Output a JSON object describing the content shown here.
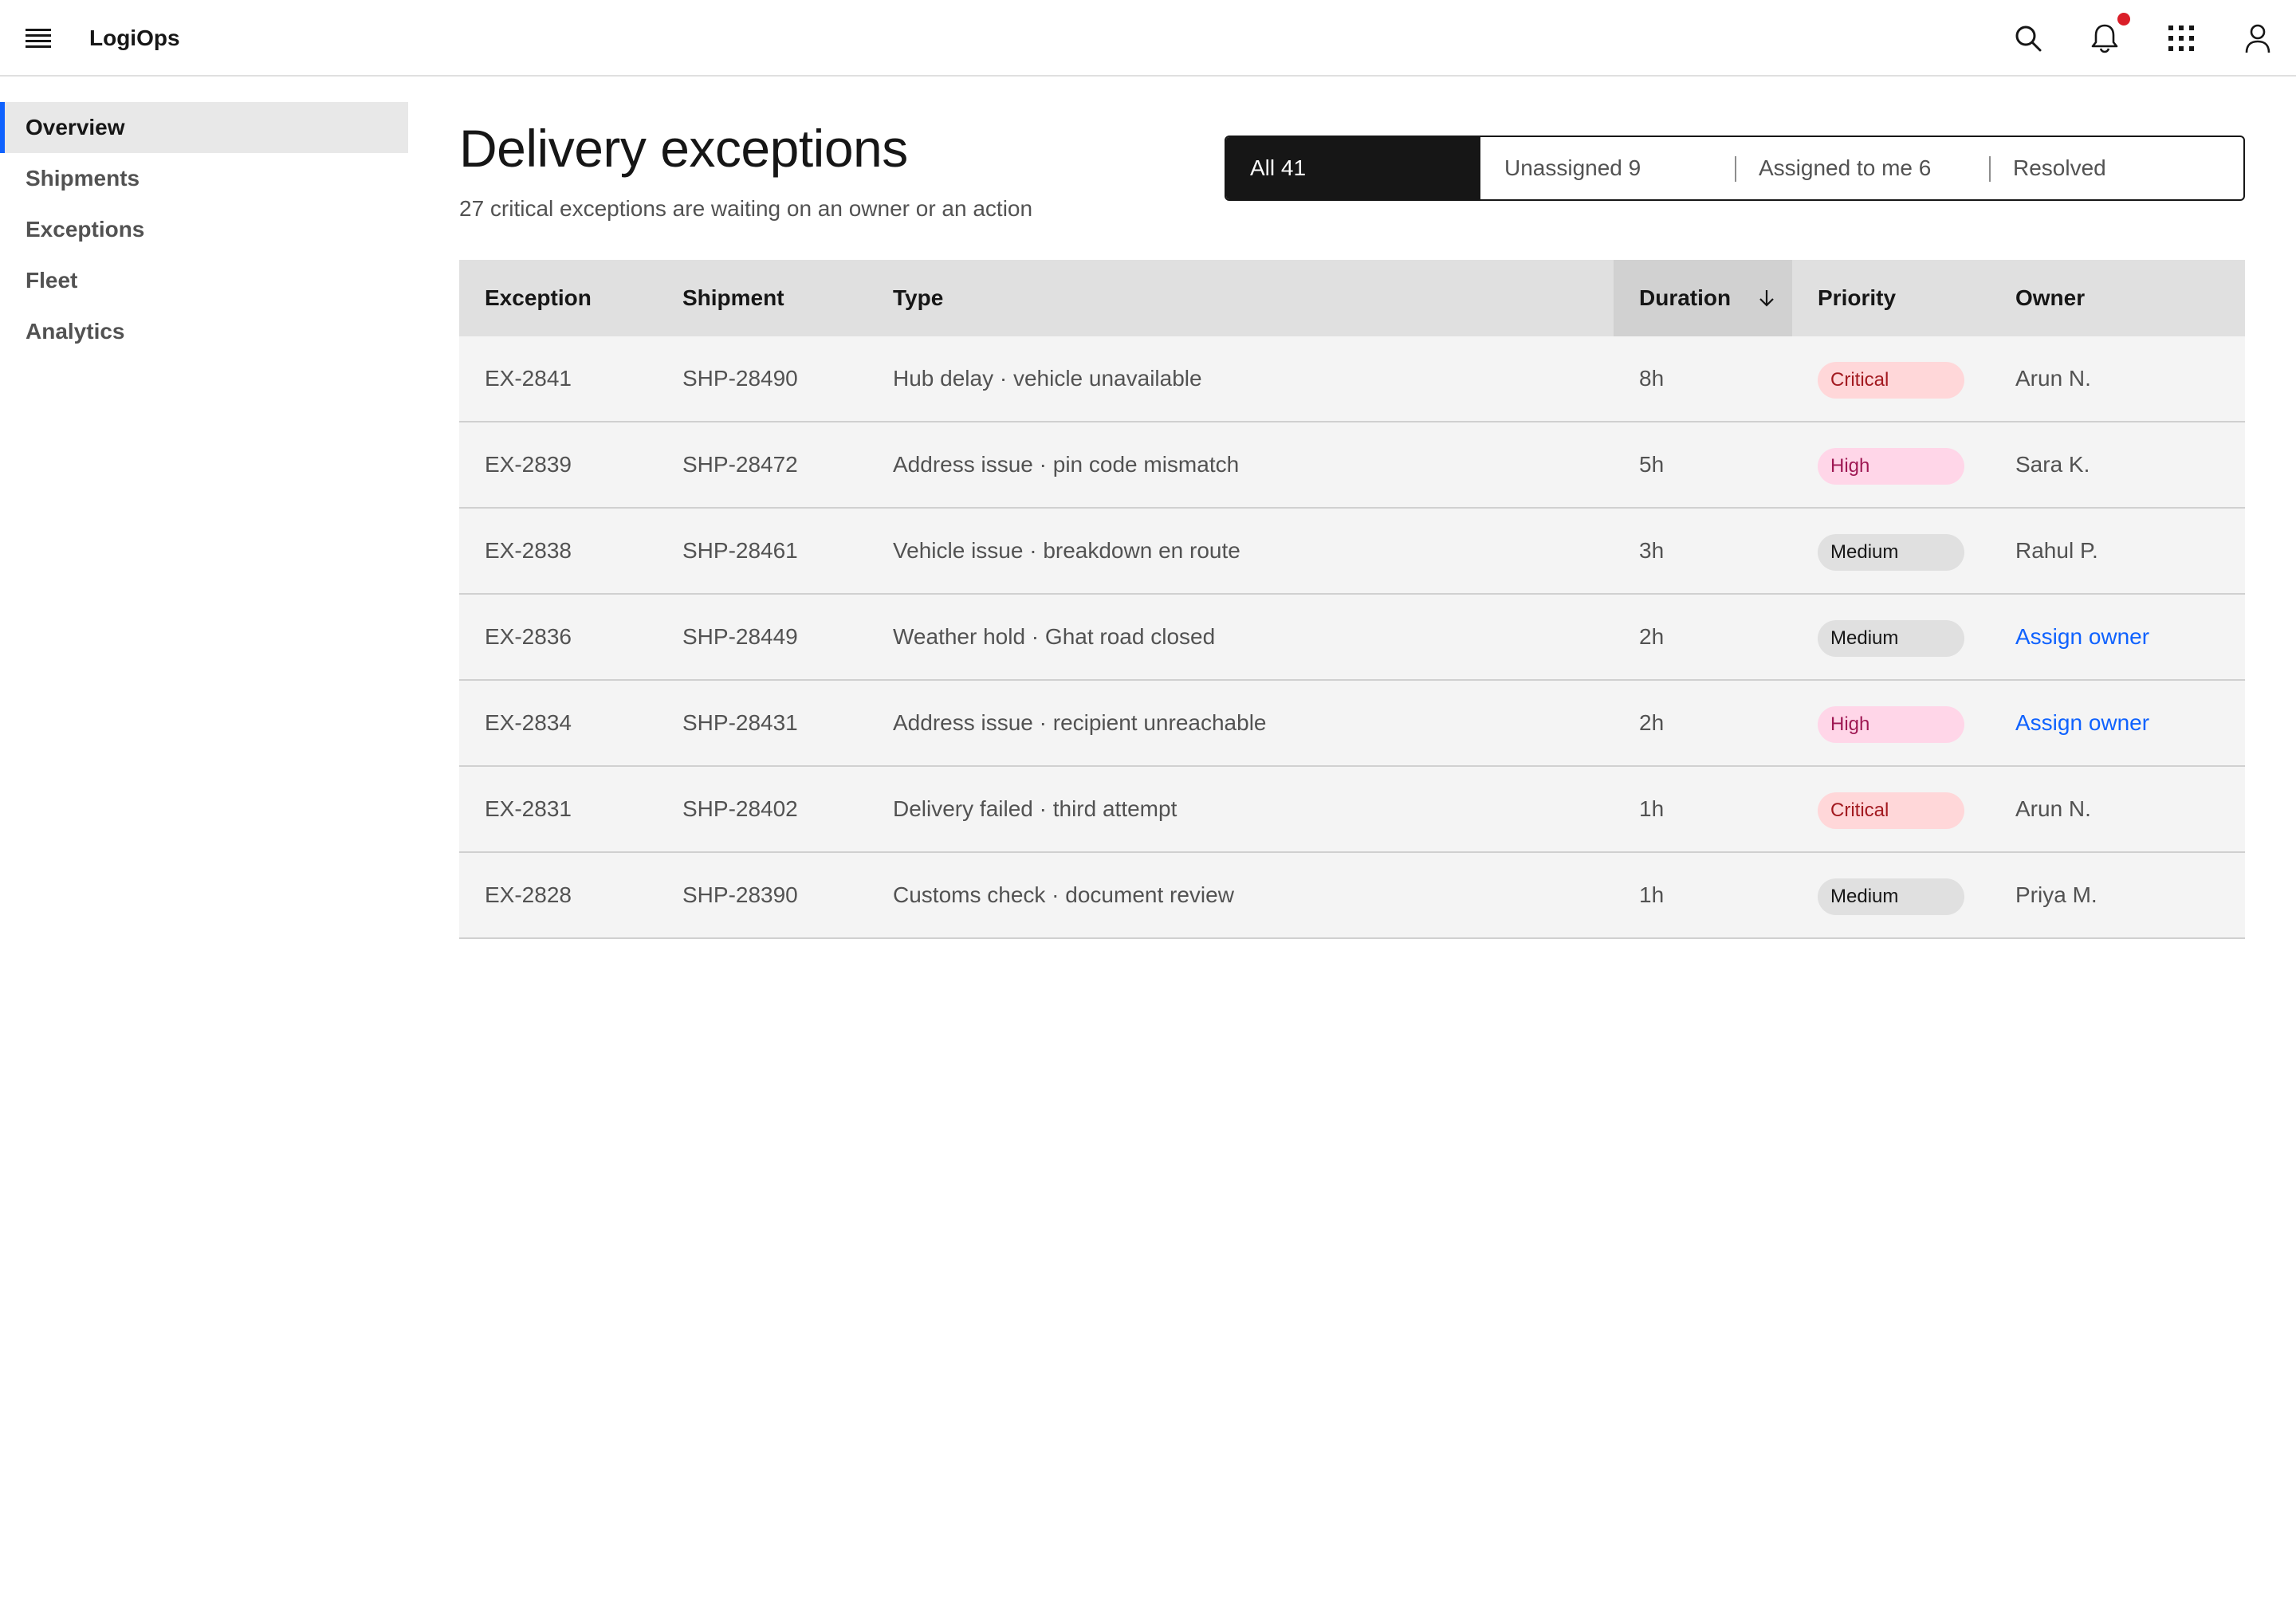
{
  "app": {
    "name": "LogiOps"
  },
  "header": {
    "icons": [
      "menu-icon",
      "search-icon",
      "bell-icon",
      "app-switcher-icon",
      "user-icon"
    ],
    "notification_dot_color": "#da1e28"
  },
  "sidebar": {
    "items": [
      {
        "label": "Overview",
        "active": true
      },
      {
        "label": "Shipments",
        "active": false
      },
      {
        "label": "Exceptions",
        "active": false
      },
      {
        "label": "Fleet",
        "active": false
      },
      {
        "label": "Analytics",
        "active": false
      }
    ]
  },
  "page": {
    "title": "Delivery exceptions",
    "subtitle": "27 critical exceptions are waiting on an owner or an action"
  },
  "filter_tabs": [
    {
      "label": "All 41",
      "active": true
    },
    {
      "label": "Unassigned 9",
      "active": false
    },
    {
      "label": "Assigned to me 6",
      "active": false
    },
    {
      "label": "Resolved",
      "active": false
    }
  ],
  "table": {
    "columns": [
      "Exception",
      "Shipment",
      "Type",
      "Duration",
      "Priority",
      "Owner"
    ],
    "sorted_column": "Duration",
    "sort_direction": "descending",
    "rows": [
      {
        "exception": "EX-2841",
        "shipment": "SHP-28490",
        "type": "Hub delay · vehicle unavailable",
        "duration": "8h",
        "priority": "Critical",
        "owner": "Arun N.",
        "owner_is_link": false
      },
      {
        "exception": "EX-2839",
        "shipment": "SHP-28472",
        "type": "Address issue · pin code mismatch",
        "duration": "5h",
        "priority": "High",
        "owner": "Sara K.",
        "owner_is_link": false
      },
      {
        "exception": "EX-2838",
        "shipment": "SHP-28461",
        "type": "Vehicle issue · breakdown en route",
        "duration": "3h",
        "priority": "Medium",
        "owner": "Rahul P.",
        "owner_is_link": false
      },
      {
        "exception": "EX-2836",
        "shipment": "SHP-28449",
        "type": "Weather hold · Ghat road closed",
        "duration": "2h",
        "priority": "Medium",
        "owner": "Assign owner",
        "owner_is_link": true
      },
      {
        "exception": "EX-2834",
        "shipment": "SHP-28431",
        "type": "Address issue · recipient unreachable",
        "duration": "2h",
        "priority": "High",
        "owner": "Assign owner",
        "owner_is_link": true
      },
      {
        "exception": "EX-2831",
        "shipment": "SHP-28402",
        "type": "Delivery failed · third attempt",
        "duration": "1h",
        "priority": "Critical",
        "owner": "Arun N.",
        "owner_is_link": false
      },
      {
        "exception": "EX-2828",
        "shipment": "SHP-28390",
        "type": "Customs check · document review",
        "duration": "1h",
        "priority": "Medium",
        "owner": "Priya M.",
        "owner_is_link": false
      }
    ]
  },
  "colors": {
    "accent": "#0f62fe",
    "active_tab_bg": "#161616",
    "critical_bg": "#ffd7d9",
    "critical_fg": "#a2191f",
    "high_bg": "#ffd6e8",
    "high_fg": "#9f1853",
    "medium_bg": "#e0e0e0",
    "medium_fg": "#161616"
  }
}
